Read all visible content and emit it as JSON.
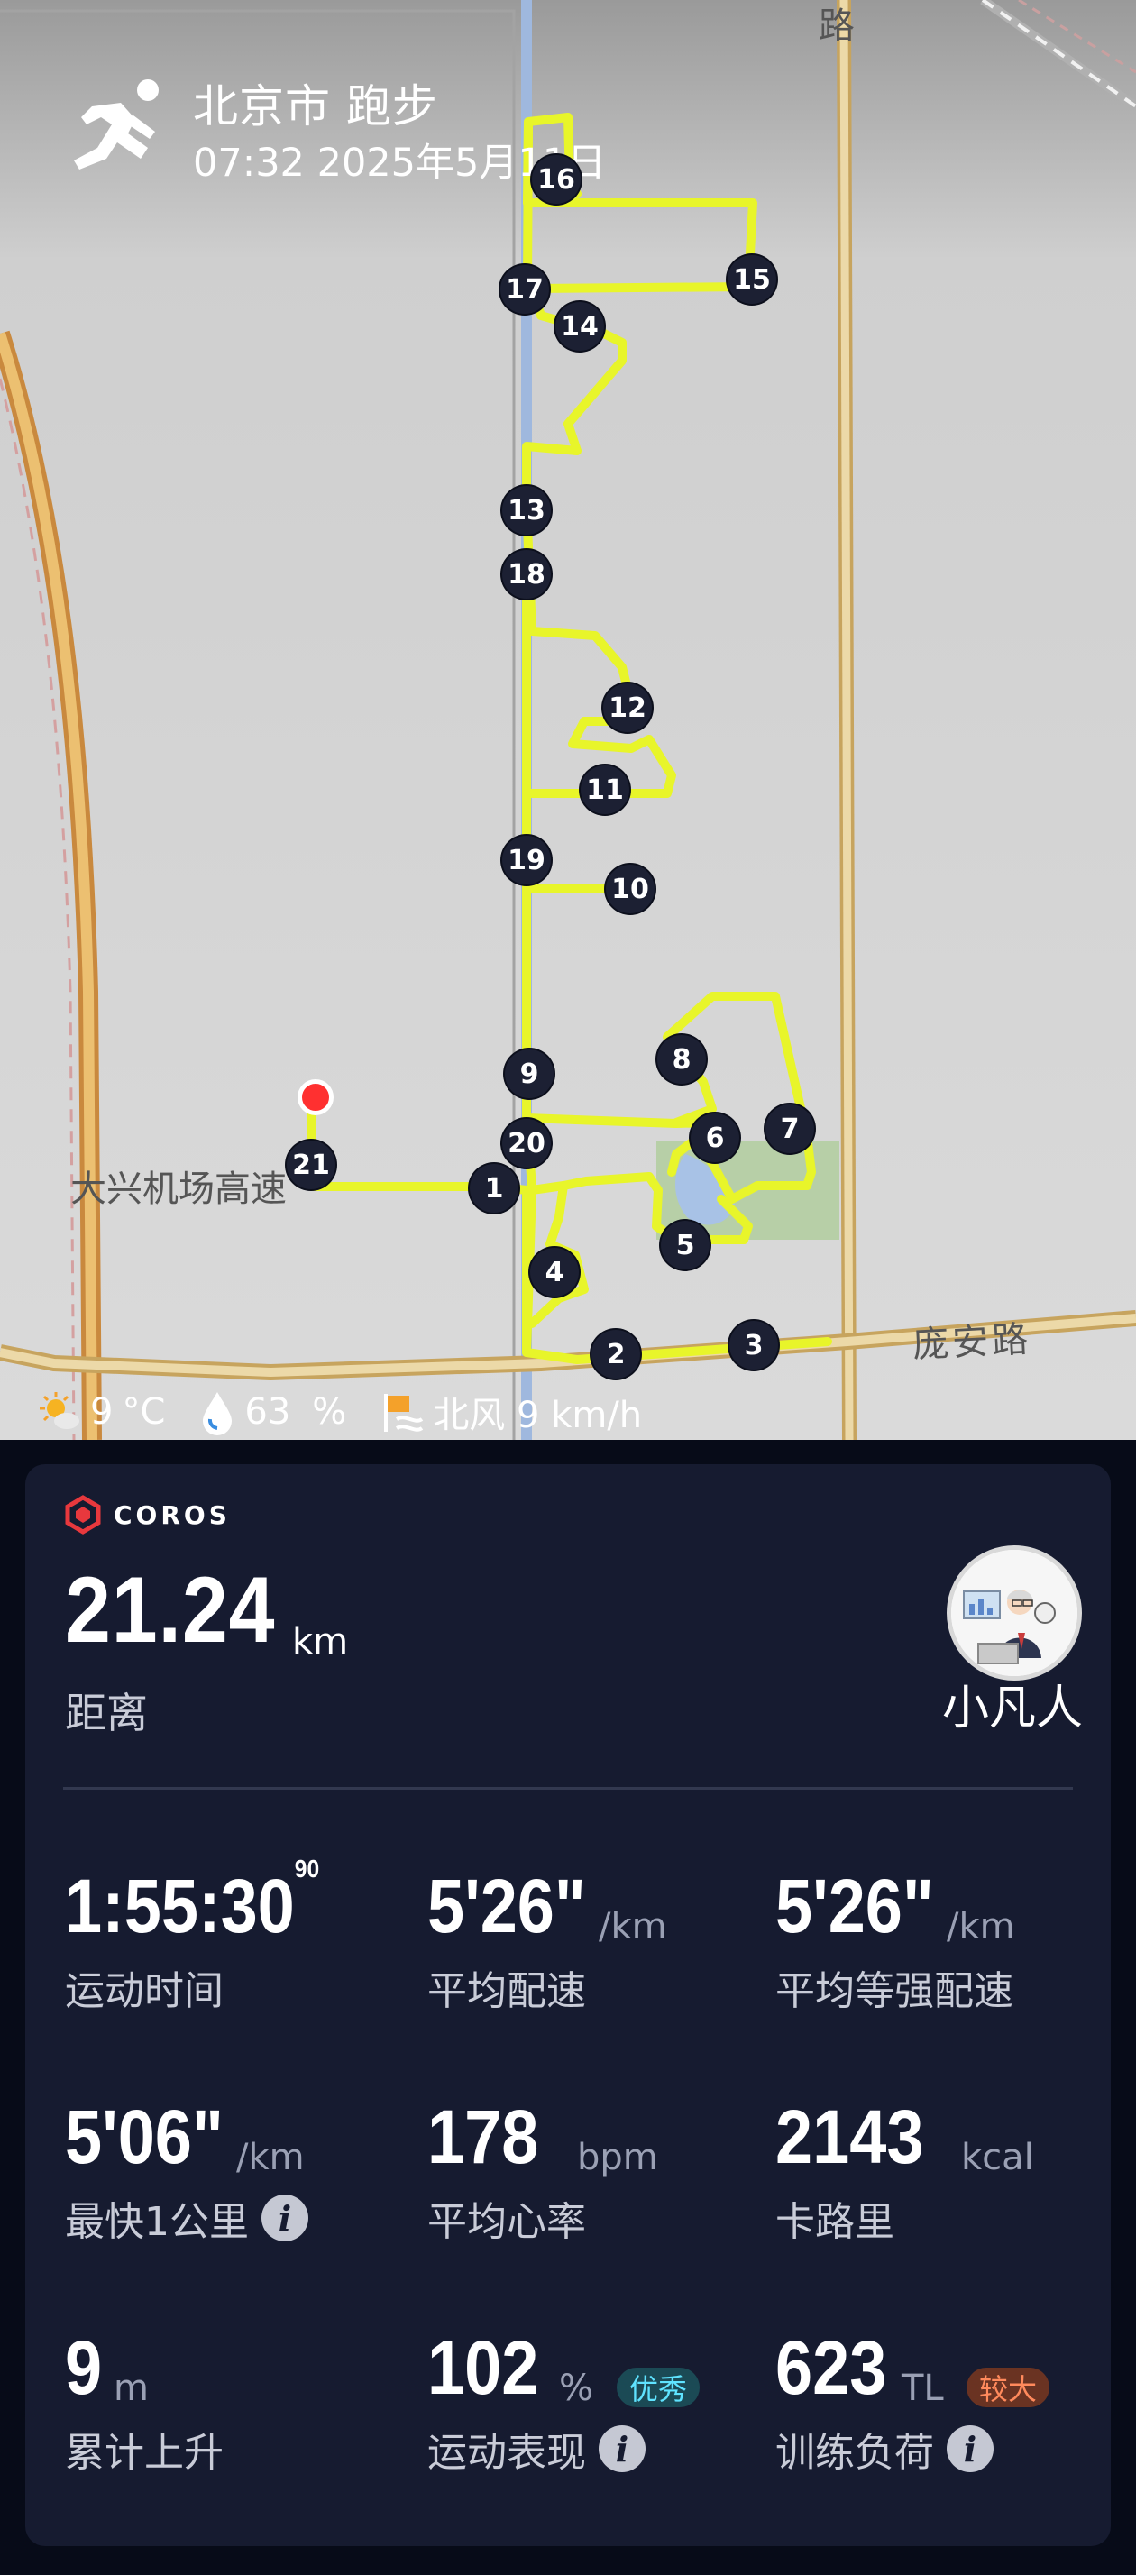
{
  "header": {
    "title": "北京市 跑步",
    "datetime": "07:32 2025年5月11日",
    "activity_icon": "running-person-icon"
  },
  "map": {
    "road_labels": {
      "top": "路",
      "pangan": "庞安路",
      "daxing": "大兴机场高速"
    },
    "route_color": "#e8f52a",
    "km_markers": [
      "1",
      "2",
      "3",
      "4",
      "5",
      "6",
      "7",
      "8",
      "9",
      "10",
      "11",
      "12",
      "13",
      "14",
      "15",
      "16",
      "17",
      "18",
      "19",
      "20",
      "21"
    ]
  },
  "weather": {
    "temperature_value": "9",
    "temperature_unit": "°C",
    "humidity_value": "63",
    "humidity_unit": "%",
    "wind": "北风 9 km/h"
  },
  "card": {
    "brand": "COROS",
    "distance_value": "21.24",
    "distance_unit": "km",
    "distance_label": "距离",
    "username": "小凡人",
    "stats": {
      "time": {
        "value": "1:55:30",
        "sup": "90",
        "label": "运动时间"
      },
      "avg_pace": {
        "value": "5'26\"",
        "unit": "/km",
        "label": "平均配速"
      },
      "avg_grade_pace": {
        "value": "5'26\"",
        "unit": "/km",
        "label": "平均等强配速"
      },
      "fastest_km": {
        "value": "5'06\"",
        "unit": "/km",
        "label": "最快1公里"
      },
      "avg_hr": {
        "value": "178",
        "unit": "bpm",
        "label": "平均心率"
      },
      "calories": {
        "value": "2143",
        "unit": "kcal",
        "label": "卡路里"
      },
      "elevation": {
        "value": "9",
        "unit": "m",
        "label": "累计上升"
      },
      "performance": {
        "value": "102",
        "unit": "%",
        "badge": "优秀",
        "label": "运动表现"
      },
      "training_load": {
        "value": "623",
        "unit": "TL",
        "badge": "较大",
        "label": "训练负荷"
      }
    }
  },
  "colors": {
    "background": "#070b18",
    "card": "#161b30",
    "badge_good": "#5fe3ff",
    "badge_high": "#ff8a5c",
    "brand_red": "#e8383d"
  }
}
